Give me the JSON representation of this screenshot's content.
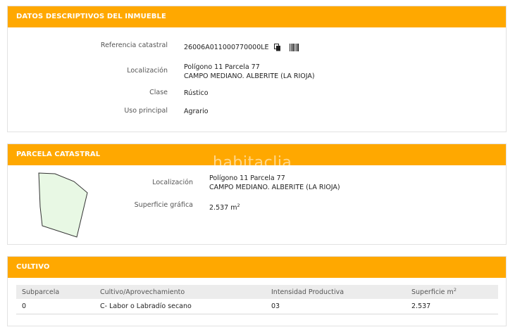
{
  "descriptivos": {
    "title": "DATOS DESCRIPTIVOS DEL INMUEBLE",
    "ref_label": "Referencia catastral",
    "ref_value": "26006A011000770000LE",
    "loc_label": "Localización",
    "loc_line1": "Polígono 11 Parcela 77",
    "loc_line2": "CAMPO MEDIANO. ALBERITE (LA RIOJA)",
    "clase_label": "Clase",
    "clase_value": "Rústico",
    "uso_label": "Uso principal",
    "uso_value": "Agrario"
  },
  "parcela": {
    "title": "PARCELA CATASTRAL",
    "loc_label": "Localización",
    "loc_line1": "Polígono 11 Parcela 77",
    "loc_line2": "CAMPO MEDIANO. ALBERITE (LA RIOJA)",
    "sup_label": "Superficie gráfica",
    "sup_value": "2.537 m",
    "sup_exp": "2",
    "shape_fill": "#e8f8e4"
  },
  "watermark": "habitaclia",
  "cultivo": {
    "title": "CULTIVO",
    "headers": {
      "subparcela": "Subparcela",
      "cultivo": "Cultivo/Aprovechamiento",
      "intensidad": "Intensidad Productiva",
      "superficie": "Superficie m",
      "superficie_exp": "2"
    },
    "rows": [
      {
        "subparcela": "0",
        "cultivo": "C- Labor o Labradío secano",
        "intensidad": "03",
        "superficie": "2.537"
      }
    ]
  },
  "colors": {
    "header": "#ffa800"
  },
  "icons": {
    "copy": "copy-icon",
    "barcode": "barcode-icon"
  }
}
